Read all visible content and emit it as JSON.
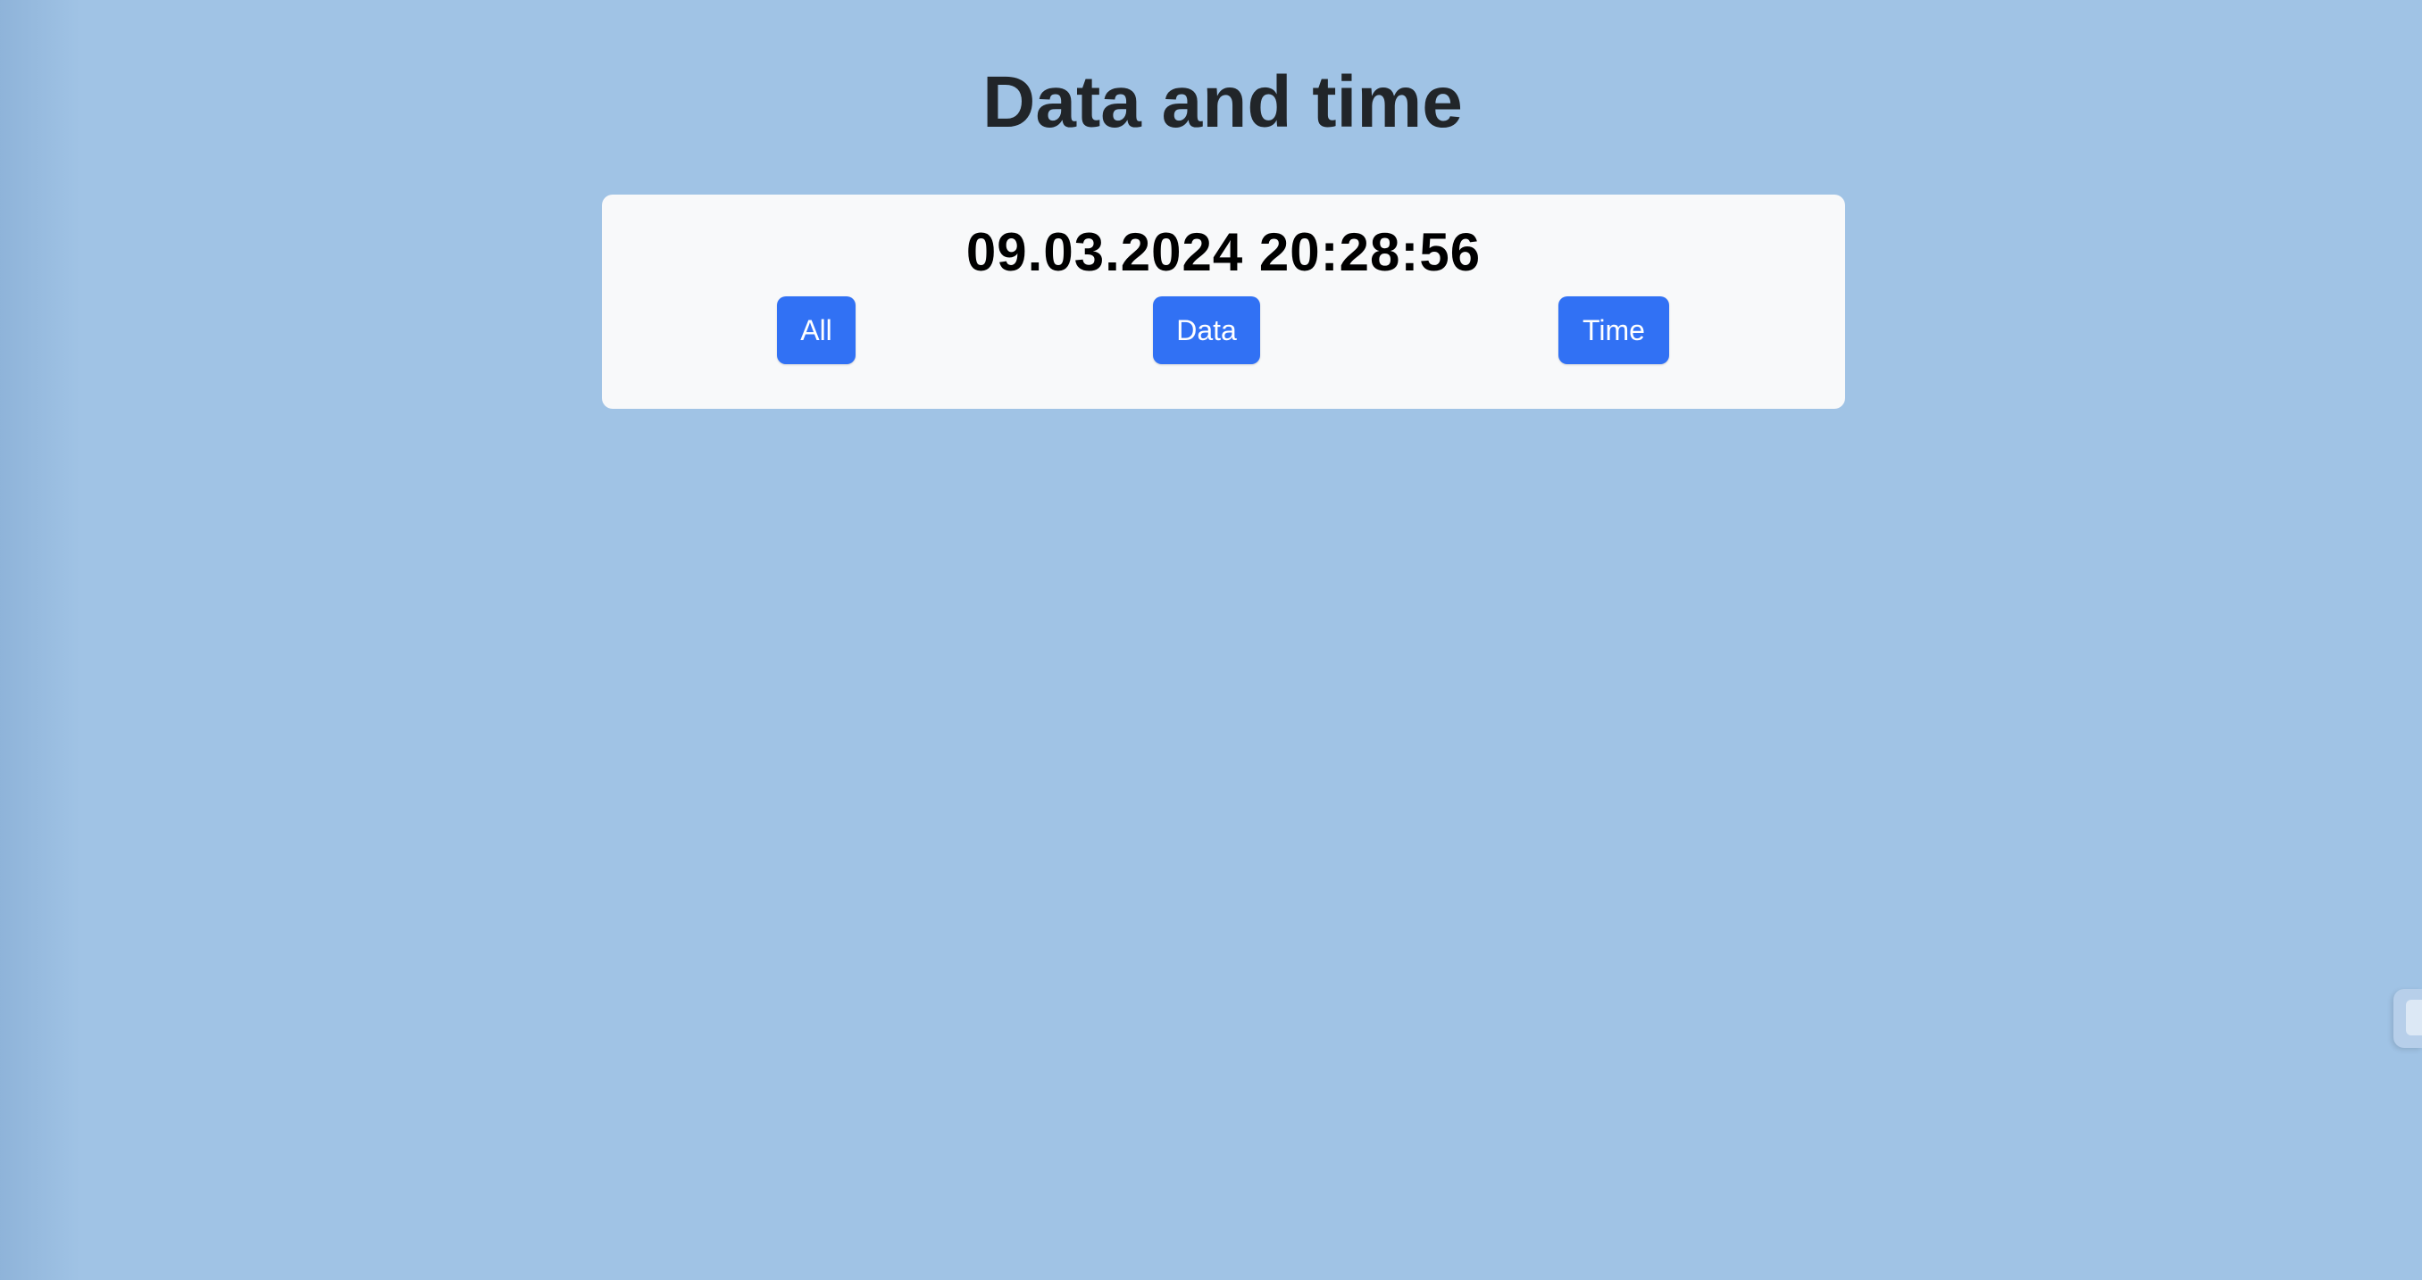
{
  "page": {
    "title": "Data and time",
    "background_color": "#a0c3e5"
  },
  "clock": {
    "display": "09.03.2024 20:28:56"
  },
  "buttons": {
    "all_label": "All",
    "data_label": "Data",
    "time_label": "Time",
    "color": "#3171f4"
  },
  "side_widget": {
    "icon": "side-panel-tab-icon"
  }
}
